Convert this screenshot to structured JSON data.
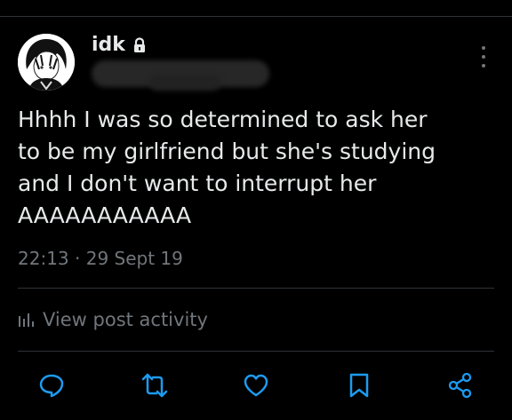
{
  "user": {
    "display_name": "idk",
    "avatar_icon": "avatar",
    "protected_icon": "lock-icon"
  },
  "post": {
    "text": "Hhhh I was so determined to ask her\nto be my girlfriend but she's studying\nand I don't want to interrupt her\nAAAAAAAAAAA",
    "time": "22:13",
    "separator": "·",
    "date": "29 Sept 19"
  },
  "activity": {
    "label": "View post activity",
    "icon": "bar-chart-icon"
  },
  "actions": [
    "reply-icon",
    "repost-icon",
    "like-icon",
    "bookmark-icon",
    "share-icon"
  ],
  "colors": {
    "background": "#000000",
    "text": "#e7e9ea",
    "muted": "#71767b",
    "divider": "#2f3336"
  }
}
